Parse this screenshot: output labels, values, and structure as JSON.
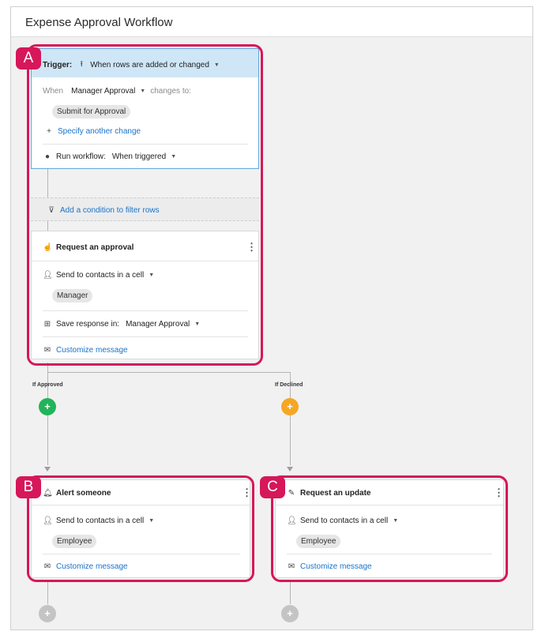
{
  "header": {
    "title": "Expense Approval Workflow"
  },
  "badges": {
    "a": "A",
    "b": "B",
    "c": "C"
  },
  "trigger": {
    "label": "Trigger:",
    "value": "When rows are added or changed",
    "when_label": "When",
    "field": "Manager Approval",
    "changes_to": "changes to:",
    "chip": "Submit for Approval",
    "add_change": "Specify another change",
    "run_label": "Run workflow:",
    "run_value": "When triggered"
  },
  "filter": {
    "label": "Add a condition to filter rows"
  },
  "approval": {
    "title": "Request an approval",
    "send_to": "Send to contacts in a cell",
    "chip": "Manager",
    "save_label": "Save response in:",
    "save_value": "Manager Approval",
    "customize": "Customize message"
  },
  "branches": {
    "approved": "If Approved",
    "declined": "If Declined",
    "plus": "+"
  },
  "alert": {
    "title": "Alert someone",
    "send_to": "Send to contacts in a cell",
    "chip": "Employee",
    "customize": "Customize message"
  },
  "update": {
    "title": "Request an update",
    "send_to": "Send to contacts in a cell",
    "chip": "Employee",
    "customize": "Customize message"
  },
  "colors": {
    "highlight": "#d6175a",
    "approved": "#22b45a",
    "declined": "#f5a623",
    "link": "#1a73c8",
    "trigger_header": "#cfe6f7",
    "add_disabled": "#c4c4c4"
  }
}
